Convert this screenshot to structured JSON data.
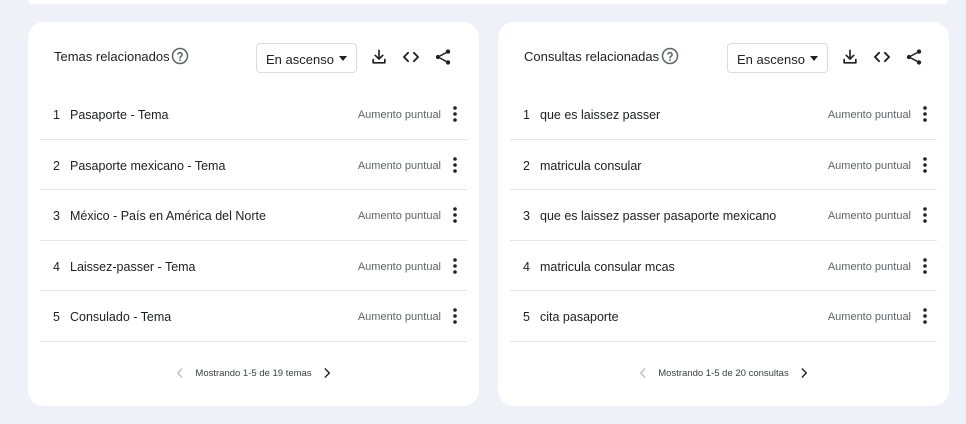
{
  "left_panel": {
    "title": "Temas relacionados",
    "sort_value": "En ascenso",
    "rows": [
      {
        "rank": "1",
        "name": "Pasaporte - Tema",
        "value": "Aumento puntual"
      },
      {
        "rank": "2",
        "name": "Pasaporte mexicano - Tema",
        "value": "Aumento puntual"
      },
      {
        "rank": "3",
        "name": "México - País en América del Norte",
        "value": "Aumento puntual"
      },
      {
        "rank": "4",
        "name": "Laissez-passer - Tema",
        "value": "Aumento puntual"
      },
      {
        "rank": "5",
        "name": "Consulado - Tema",
        "value": "Aumento puntual"
      }
    ],
    "pagination": "Mostrando 1-5 de 19 temas"
  },
  "right_panel": {
    "title": "Consultas relacionadas",
    "sort_value": "En ascenso",
    "rows": [
      {
        "rank": "1",
        "name": "que es laissez passer",
        "value": "Aumento puntual"
      },
      {
        "rank": "2",
        "name": "matricula consular",
        "value": "Aumento puntual"
      },
      {
        "rank": "3",
        "name": "que es laissez passer pasaporte mexicano",
        "value": "Aumento puntual"
      },
      {
        "rank": "4",
        "name": "matricula consular mcas",
        "value": "Aumento puntual"
      },
      {
        "rank": "5",
        "name": "cita pasaporte",
        "value": "Aumento puntual"
      }
    ],
    "pagination": "Mostrando 1-5 de 20 consultas"
  },
  "icons": {
    "help": "help-circle-icon",
    "download": "download-icon",
    "embed": "embed-code-icon",
    "share": "share-icon",
    "more": "more-vert-icon",
    "prev": "chevron-left-icon",
    "next": "chevron-right-icon"
  },
  "colors": {
    "background": "#eef2f8",
    "card": "#ffffff",
    "text": "#202124",
    "muted": "#5f6368",
    "divider": "#e3e5e8",
    "disabled": "#bdc1c6"
  }
}
